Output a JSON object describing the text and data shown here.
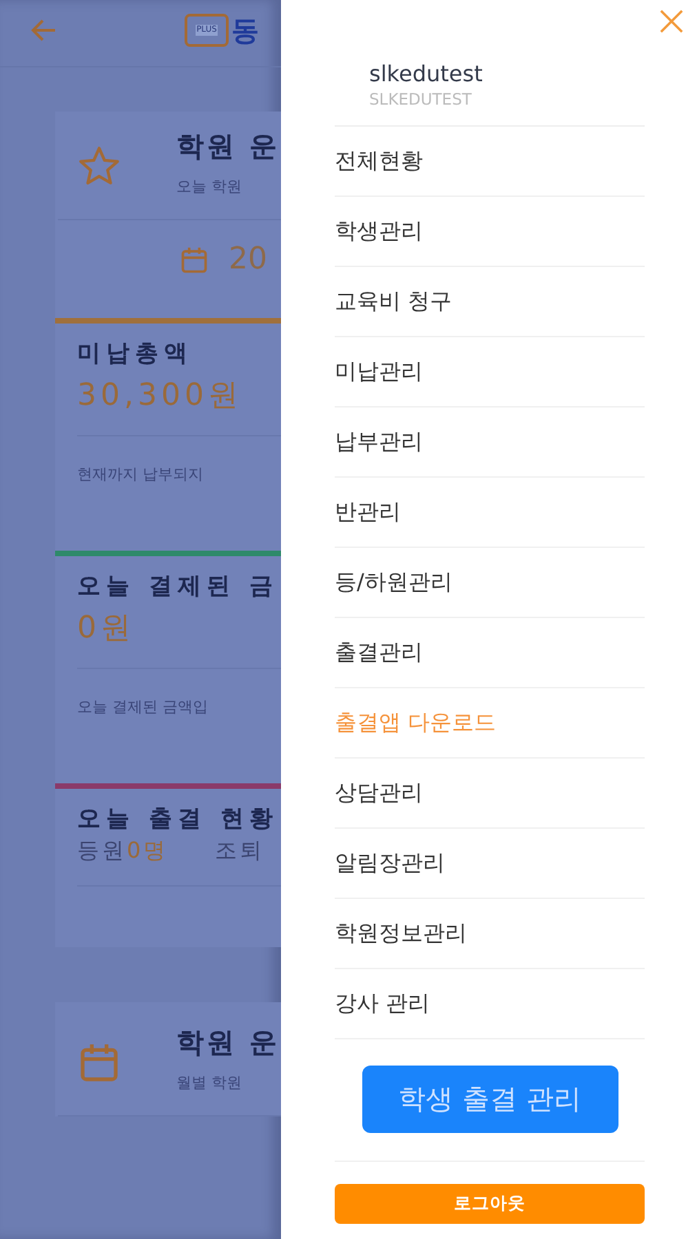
{
  "background_page": {
    "logo_badge": "PLUS",
    "title": "동",
    "summary_card": {
      "title": "학원 운",
      "note": "오늘 학원",
      "date": "20"
    },
    "stats": [
      {
        "kind": "amount",
        "color": "#a0703c",
        "label": "미납총액",
        "value": "30,300원",
        "note": "현재까지 납부되지"
      },
      {
        "kind": "amount",
        "color": "#2e8a6a",
        "label": "오늘 결제된 금",
        "value": "0원",
        "note": "오늘 결제된 금액입"
      },
      {
        "kind": "attendance",
        "color": "#8a3a6a",
        "label": "오늘 출결 현황",
        "present_label": "등원",
        "present_count": "0",
        "present_unit": "명",
        "early_label": "조퇴"
      }
    ],
    "monthly_card": {
      "title": "학원 운",
      "note": "월별 학원"
    }
  },
  "drawer": {
    "user": {
      "name": "slkedutest",
      "id": "SLKEDUTEST"
    },
    "menu": [
      {
        "label": "전체현황",
        "accent": false
      },
      {
        "label": "학생관리",
        "accent": false
      },
      {
        "label": "교육비 청구",
        "accent": false
      },
      {
        "label": "미납관리",
        "accent": false
      },
      {
        "label": "납부관리",
        "accent": false
      },
      {
        "label": "반관리",
        "accent": false
      },
      {
        "label": "등/하원관리",
        "accent": false
      },
      {
        "label": "출결관리",
        "accent": false
      },
      {
        "label": "출결앱 다운로드",
        "accent": true
      },
      {
        "label": "상담관리",
        "accent": false
      },
      {
        "label": "알림장관리",
        "accent": false
      },
      {
        "label": "학원정보관리",
        "accent": false
      },
      {
        "label": "강사 관리",
        "accent": false
      }
    ],
    "primary_button": "학생 출결 관리",
    "logout_button": "로그아웃"
  }
}
